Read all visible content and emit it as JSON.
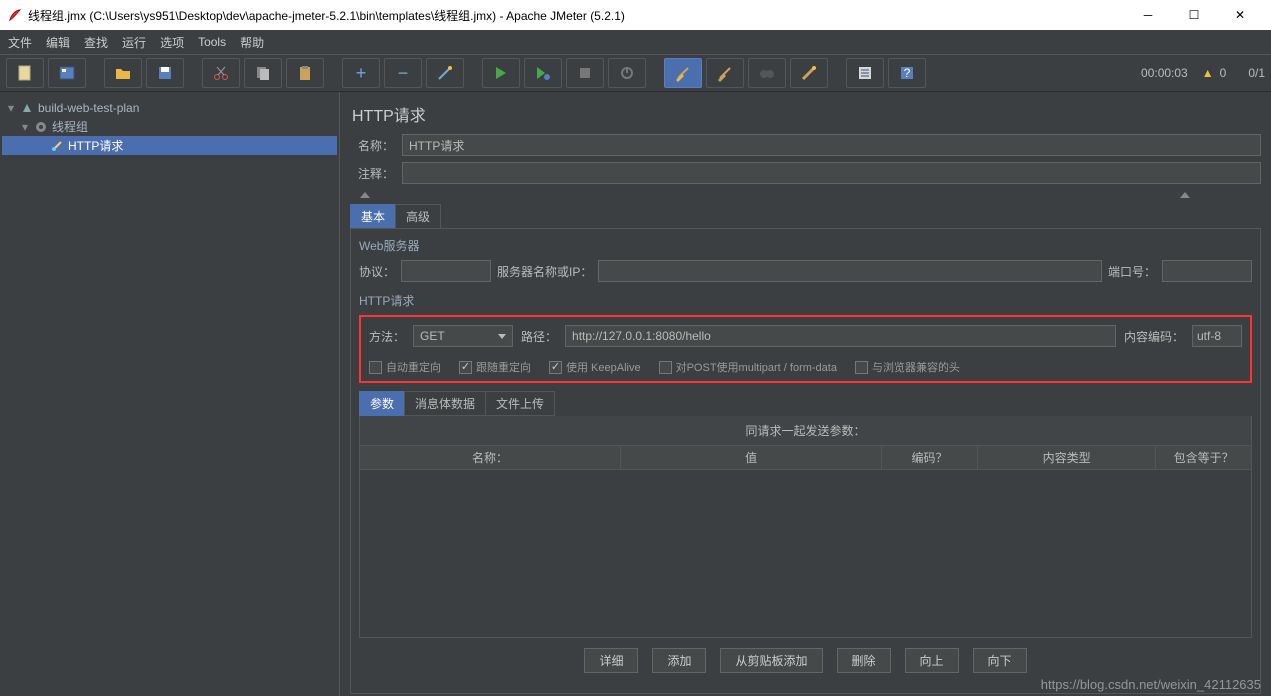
{
  "window": {
    "title": "线程组.jmx (C:\\Users\\ys951\\Desktop\\dev\\apache-jmeter-5.2.1\\bin\\templates\\线程组.jmx) - Apache JMeter (5.2.1)"
  },
  "menu": [
    "文件",
    "编辑",
    "查找",
    "运行",
    "选项",
    "Tools",
    "帮助"
  ],
  "status": {
    "timer": "00:00:03",
    "warnings": "0",
    "threads": "0/1"
  },
  "tree": {
    "root": {
      "label": "build-web-test-plan"
    },
    "child1": {
      "label": "线程组"
    },
    "child2": {
      "label": "HTTP请求"
    }
  },
  "http": {
    "heading": "HTTP请求",
    "name_label": "名称：",
    "name_value": "HTTP请求",
    "comment_label": "注释：",
    "comment_value": "",
    "tabs": {
      "basic": "基本",
      "advanced": "高级"
    },
    "webserver": {
      "legend": "Web服务器",
      "protocol_label": "协议：",
      "protocol_value": "",
      "server_label": "服务器名称或IP：",
      "server_value": "",
      "port_label": "端口号：",
      "port_value": ""
    },
    "request": {
      "legend": "HTTP请求",
      "method_label": "方法：",
      "method_value": "GET",
      "path_label": "路径：",
      "path_value": "http://127.0.0.1:8080/hello",
      "encoding_label": "内容编码：",
      "encoding_value": "utf-8",
      "cb_auto_redirect": "自动重定向",
      "cb_follow_redirect": "跟随重定向",
      "cb_keepalive": "使用 KeepAlive",
      "cb_multipart": "对POST使用multipart / form-data",
      "cb_browser_headers": "与浏览器兼容的头"
    },
    "params": {
      "tabs": {
        "params": "参数",
        "body": "消息体数据",
        "files": "文件上传"
      },
      "header": "同请求一起发送参数：",
      "cols": {
        "name": "名称：",
        "value": "值",
        "encode": "编码？",
        "ctype": "内容类型",
        "include": "包含等于？"
      }
    },
    "buttons": {
      "detail": "详细",
      "add": "添加",
      "clipboard": "从剪贴板添加",
      "delete": "删除",
      "up": "向上",
      "down": "向下"
    }
  },
  "watermark": "https://blog.csdn.net/weixin_42112635"
}
